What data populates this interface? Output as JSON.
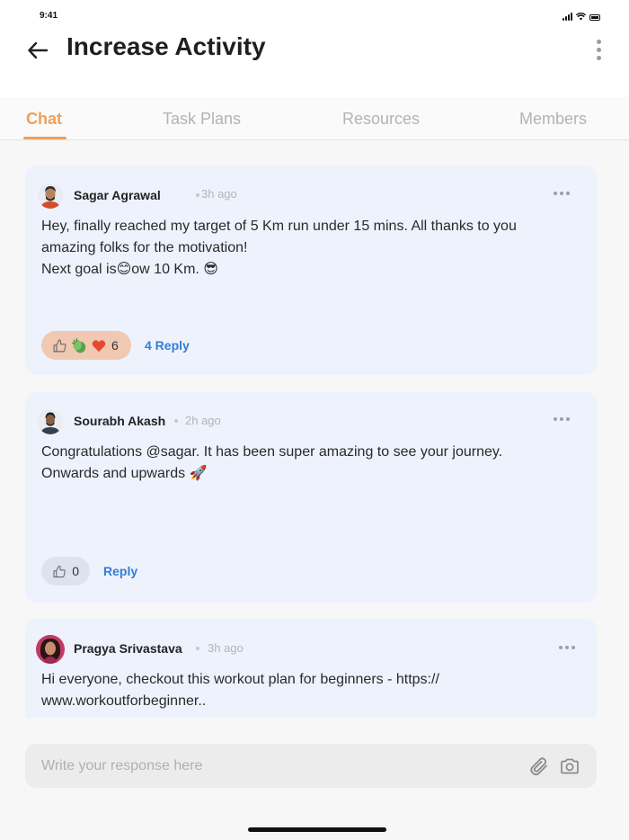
{
  "status_bar": {
    "time": "9:41"
  },
  "header": {
    "title": "Increase Activity"
  },
  "tabs": [
    {
      "label": "Chat",
      "active": true
    },
    {
      "label": "Task Plans",
      "active": false
    },
    {
      "label": "Resources",
      "active": false
    },
    {
      "label": "Members",
      "active": false
    }
  ],
  "posts": [
    {
      "author": "Sagar Agrawal",
      "time": "3h ago",
      "lines": [
        "Hey, finally reached my target of 5 Km run under 15 mins. All thanks to you",
        "amazing folks for the motivation!",
        "Next goal is😊ow 10 Km. 😎"
      ],
      "reaction_count": "6",
      "reply_label": "4 Reply",
      "reactions": [
        "thumbs-up",
        "clapping-hands",
        "heart"
      ]
    },
    {
      "author": "Sourabh Akash",
      "time": "2h ago",
      "lines": [
        "Congratulations @sagar.  It has been super amazing to see your journey.",
        "Onwards and upwards 🚀"
      ],
      "reaction_count": "0",
      "reply_label": "Reply",
      "reactions": [
        "thumbs-up"
      ]
    },
    {
      "author": "Pragya Srivastava",
      "time": "3h ago",
      "lines": [
        "Hi everyone, checkout this workout plan for beginners - https://",
        "www.workoutforbeginner.."
      ]
    }
  ],
  "composer": {
    "placeholder": "Write your response here"
  },
  "colors": {
    "accent": "#f0a05a",
    "link": "#2f80d8",
    "card_bg": "#edf2fd",
    "reaction_pill": "#f1c8b1"
  },
  "icons": [
    "back-arrow-icon",
    "more-vertical-icon",
    "more-horizontal-icon",
    "attachment-icon",
    "camera-icon"
  ]
}
